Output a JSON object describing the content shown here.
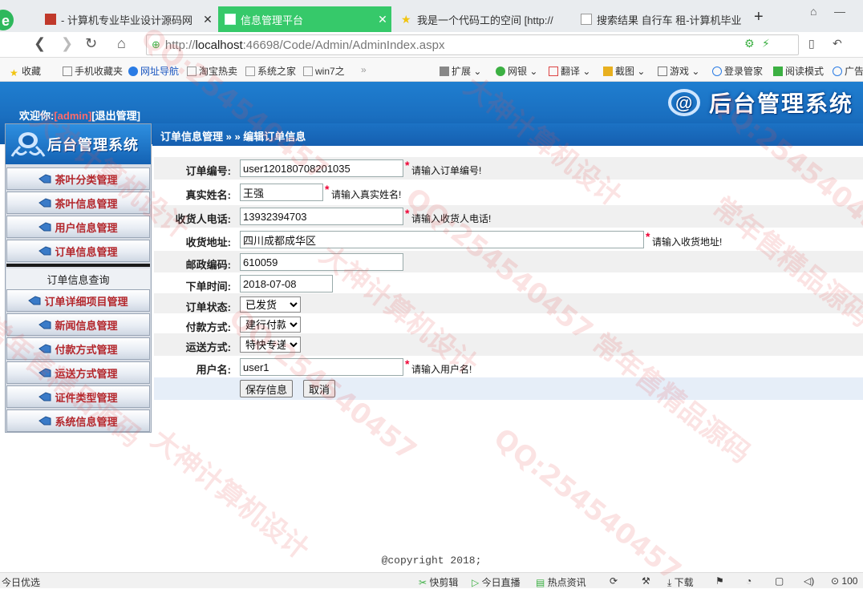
{
  "browser": {
    "tabs": [
      {
        "label": "- 计算机专业毕业设计源码网",
        "active": false
      },
      {
        "label": "信息管理平台",
        "active": true
      },
      {
        "label": "我是一个代码工的空间 [http://",
        "active": false
      },
      {
        "label": "搜索结果 自行车 租-计算机毕业",
        "active": false
      }
    ],
    "url_prefix": "http://",
    "url_host": "localhost",
    "url_rest": ":46698/Code/Admin/AdminIndex.aspx",
    "bookmarks": [
      "收藏",
      "手机收藏夹",
      "网址导航",
      "淘宝热卖",
      "系统之家",
      "win7之",
      "扩展",
      "网银",
      "翻译",
      "截图",
      "游戏",
      "登录管家",
      "阅读模式",
      "广告"
    ],
    "status_items": [
      "今日优选",
      "快剪辑",
      "今日直播",
      "热点资讯",
      "下载",
      "100"
    ]
  },
  "header": {
    "title": "后台管理系统",
    "welcome_prefix": "欢迎你:",
    "user": "[admin]",
    "logout": "[退出管理]",
    "breadcrumb": "订单信息管理 » » 编辑订单信息"
  },
  "sidebar": {
    "logo_text": "后台管理系统",
    "items": [
      {
        "label": "茶叶分类管理"
      },
      {
        "label": "茶叶信息管理"
      },
      {
        "label": "用户信息管理"
      },
      {
        "label": "订单信息管理"
      }
    ],
    "submenu": "订单信息查询",
    "items2": [
      {
        "label": "订单详细项目管理"
      },
      {
        "label": "新闻信息管理"
      },
      {
        "label": "付款方式管理"
      },
      {
        "label": "运送方式管理"
      },
      {
        "label": "证件类型管理"
      },
      {
        "label": "系统信息管理"
      }
    ]
  },
  "form": {
    "order_no": {
      "label": "订单编号:",
      "value": "user120180708201035",
      "hint": "请输入订单编号!"
    },
    "real_name": {
      "label": "真实姓名:",
      "value": "王强",
      "hint": "请输入真实姓名!"
    },
    "phone": {
      "label": "收货人电话:",
      "value": "13932394703",
      "hint": "请输入收货人电话!"
    },
    "address": {
      "label": "收货地址:",
      "value": "四川成都成华区",
      "hint": "请输入收货地址!"
    },
    "postcode": {
      "label": "邮政编码:",
      "value": "610059"
    },
    "order_time": {
      "label": "下单时间:",
      "value": "2018-07-08"
    },
    "status": {
      "label": "订单状态:",
      "value": "已发货"
    },
    "payment": {
      "label": "付款方式:",
      "value": "建行付款"
    },
    "shipping": {
      "label": "运送方式:",
      "value": "特快专递"
    },
    "username": {
      "label": "用户名:",
      "value": "user1",
      "hint": "请输入用户名!"
    },
    "required_mark": "*",
    "save_label": "保存信息",
    "cancel_label": "取消"
  },
  "footer": {
    "copyright": "@copyright 2018;"
  },
  "watermarks": [
    "QQ:254540457",
    "大神计算机设计",
    "常年售精品源码",
    "QQ:254540457",
    "大神计算机设计",
    "常年售精品源码",
    "QQ:254540457",
    "大神计算机设计",
    "QQ:254540457",
    "常年售精品源码",
    "大神计算机设计",
    "QQ:254540457"
  ],
  "colors": {
    "banner": "#1a6fc0",
    "menu_text": "#b3262b",
    "active_tab": "#36c96a",
    "required": "#e00033"
  }
}
